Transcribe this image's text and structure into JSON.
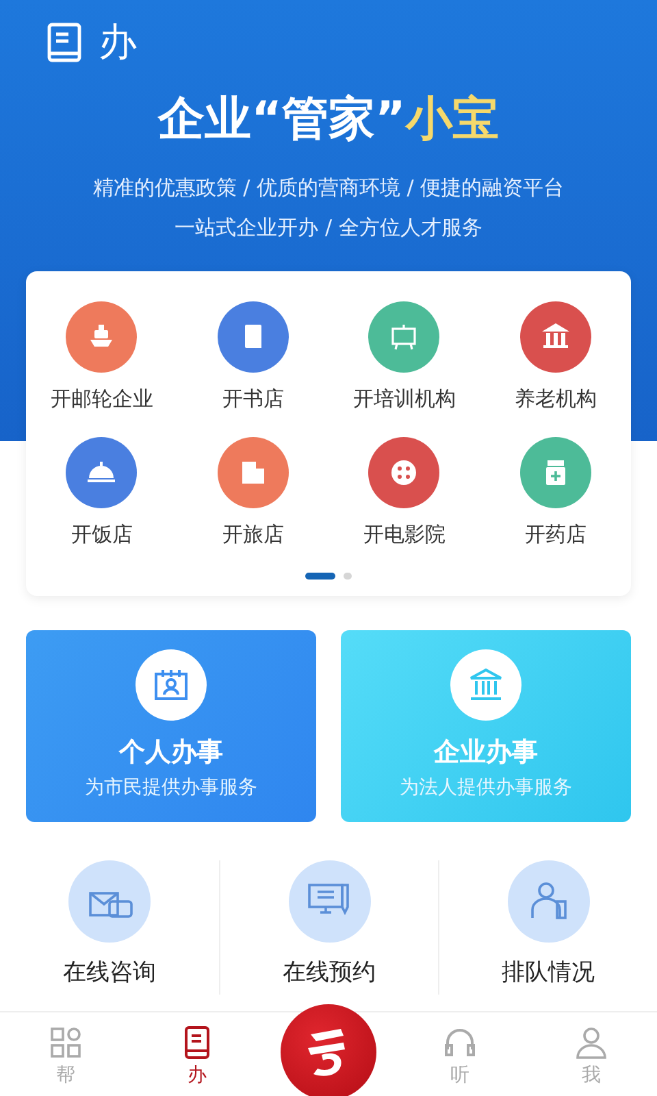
{
  "header": {
    "icon_label": "办",
    "title": "企业“管家”",
    "title_highlight": "小宝",
    "taglines": [
      "精准的优惠政策 / 优质的营商环境 / 便捷的融资平台",
      "一站式企业开办 / 全方位人才服务"
    ]
  },
  "categories": [
    {
      "label": "开邮轮企业",
      "color": "#ee7a5c"
    },
    {
      "label": "开书店",
      "color": "#4a7fe0"
    },
    {
      "label": "开培训机构",
      "color": "#4dbb98"
    },
    {
      "label": "养老机构",
      "color": "#d9504e"
    },
    {
      "label": "开饭店",
      "color": "#4a7fe0"
    },
    {
      "label": "开旅店",
      "color": "#ee7a5c"
    },
    {
      "label": "开电影院",
      "color": "#d9504e"
    },
    {
      "label": "开药店",
      "color": "#4dbb98"
    }
  ],
  "pager": [
    {
      "selected": true
    },
    {
      "selected": false
    }
  ],
  "tiles": [
    {
      "title": "个人办事",
      "subtitle": "为市民提供办事服务",
      "kind": "personal"
    },
    {
      "title": "企业办事",
      "subtitle": "为法人提供办事服务",
      "kind": "business"
    }
  ],
  "services": [
    {
      "label": "在线咨询"
    },
    {
      "label": "在线预约"
    },
    {
      "label": "排队情况"
    }
  ],
  "tab_bar": [
    {
      "kind": "tab",
      "label": "帮",
      "selected": false
    },
    {
      "kind": "tab",
      "label": "办",
      "selected": true
    },
    {
      "kind": "logo"
    },
    {
      "kind": "tab",
      "label": "听",
      "selected": false
    },
    {
      "kind": "tab",
      "label": "我",
      "selected": false
    }
  ]
}
